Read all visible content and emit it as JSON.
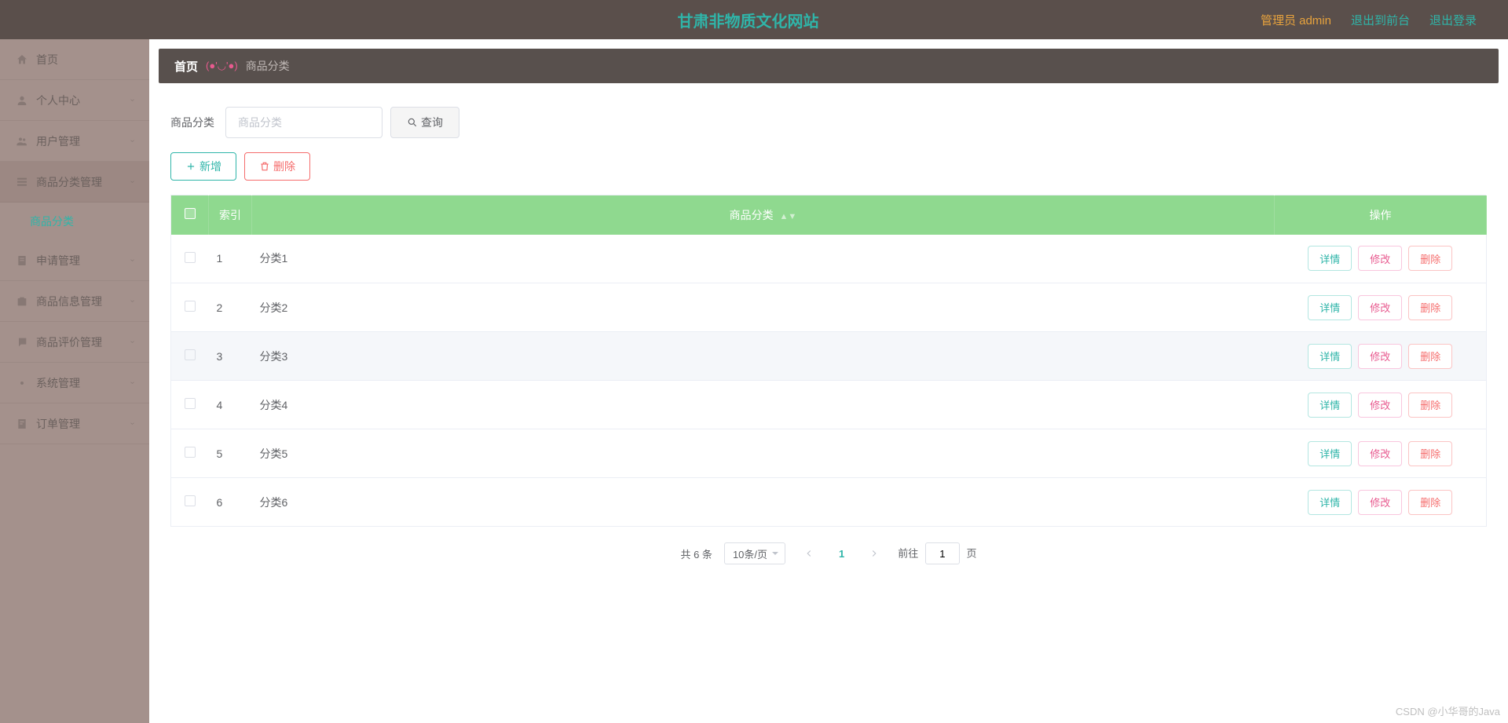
{
  "header": {
    "title": "甘肃非物质文化网站",
    "admin_label": "管理员 admin",
    "frontend_label": "退出到前台",
    "logout_label": "退出登录"
  },
  "sidebar": {
    "items": [
      {
        "label": "首页",
        "icon": "home-icon"
      },
      {
        "label": "个人中心",
        "icon": "user-icon"
      },
      {
        "label": "用户管理",
        "icon": "users-icon"
      },
      {
        "label": "商品分类管理",
        "icon": "category-icon",
        "expanded": true
      },
      {
        "label": "申请管理",
        "icon": "apply-icon"
      },
      {
        "label": "商品信息管理",
        "icon": "product-icon"
      },
      {
        "label": "商品评价管理",
        "icon": "review-icon"
      },
      {
        "label": "系统管理",
        "icon": "system-icon"
      },
      {
        "label": "订单管理",
        "icon": "order-icon"
      }
    ],
    "sub_label": "商品分类"
  },
  "breadcrumb": {
    "home": "首页",
    "face": "(●'◡'●)",
    "current": "商品分类"
  },
  "search": {
    "label": "商品分类",
    "placeholder": "商品分类",
    "button": "查询"
  },
  "actions": {
    "add": "新增",
    "delete": "删除"
  },
  "table": {
    "headers": {
      "index": "索引",
      "category": "商品分类",
      "action": "操作"
    },
    "row_actions": {
      "detail": "详情",
      "edit": "修改",
      "delete": "删除"
    },
    "rows": [
      {
        "index": "1",
        "name": "分类1"
      },
      {
        "index": "2",
        "name": "分类2"
      },
      {
        "index": "3",
        "name": "分类3"
      },
      {
        "index": "4",
        "name": "分类4"
      },
      {
        "index": "5",
        "name": "分类5"
      },
      {
        "index": "6",
        "name": "分类6"
      }
    ]
  },
  "pagination": {
    "total_text": "共 6 条",
    "page_size": "10条/页",
    "current": "1",
    "jump_prefix": "前往",
    "jump_suffix": "页",
    "jump_value": "1"
  },
  "watermark": "CSDN @小华哥的Java"
}
